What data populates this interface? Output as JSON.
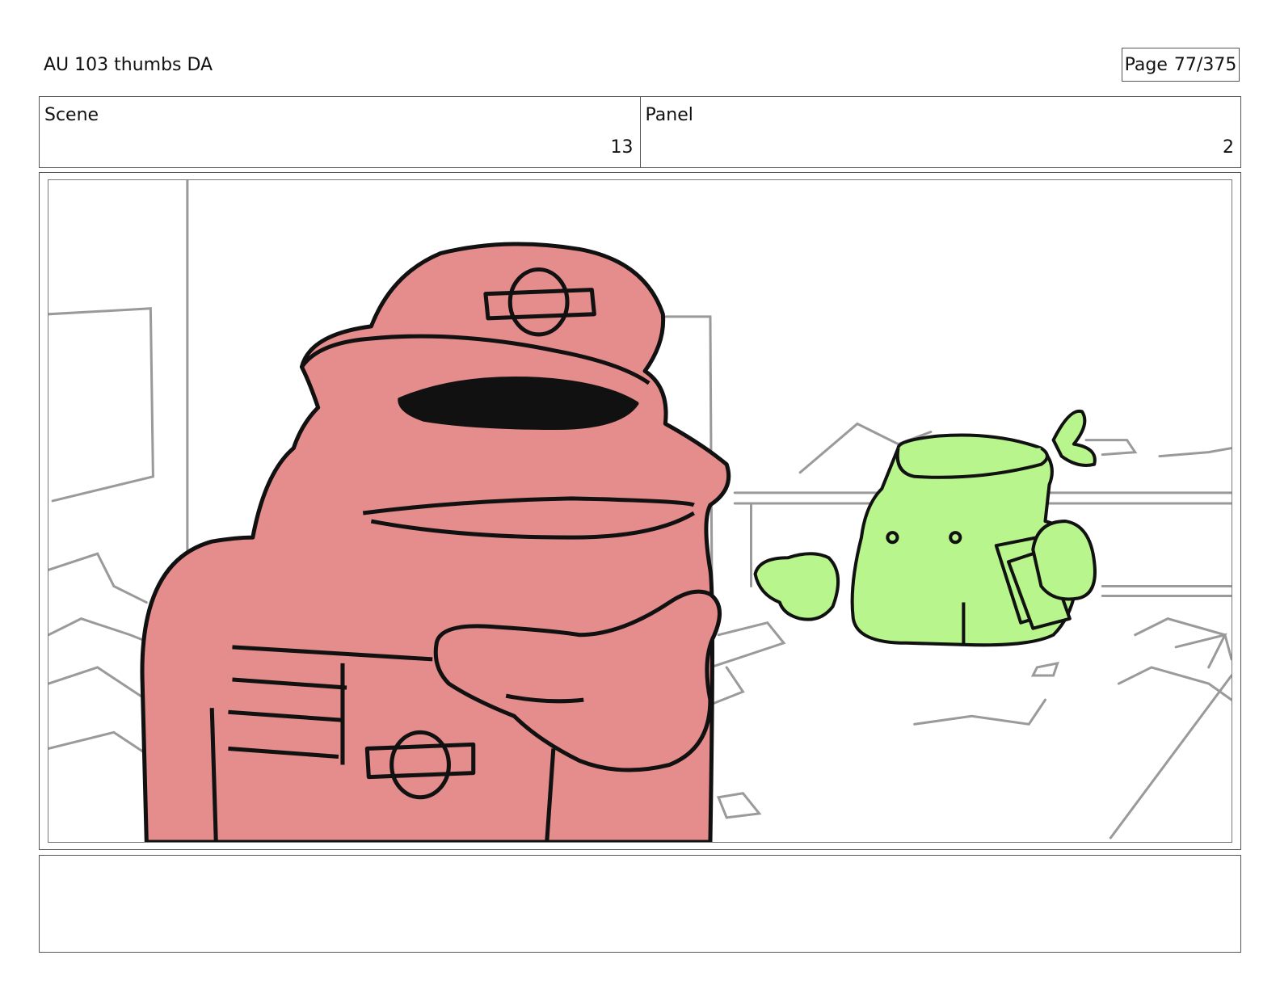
{
  "header": {
    "title": "AU 103 thumbs DA",
    "page_label": "Page",
    "page_value": "77/375"
  },
  "info": {
    "scene_label": "Scene",
    "scene_value": "13",
    "panel_label": "Panel",
    "panel_value": "2"
  },
  "notes": {
    "text": ""
  },
  "colors": {
    "red_character": "#e58c8c",
    "green_character": "#b8f58c",
    "outline": "#111111",
    "sketch": "#9a9a9a"
  }
}
